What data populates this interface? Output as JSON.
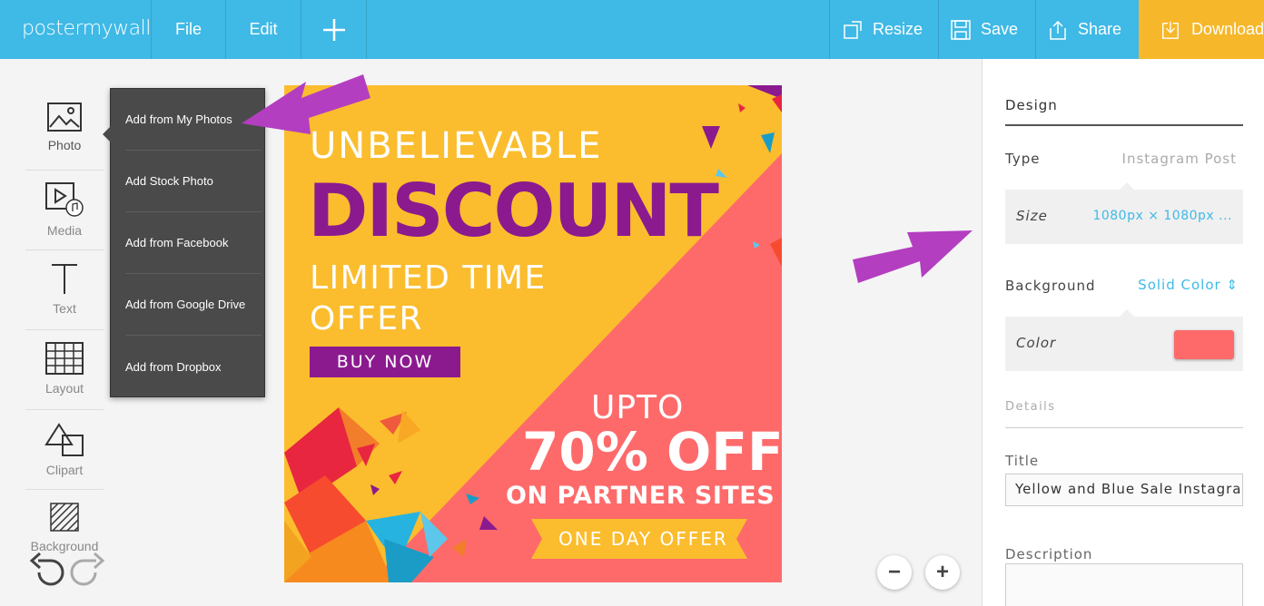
{
  "topbar": {
    "logo": "postermywall",
    "file_label": "File",
    "edit_label": "Edit",
    "add_icon": "plus-icon",
    "resize_label": "Resize",
    "save_label": "Save",
    "share_label": "Share",
    "download_label": "Download",
    "colors": {
      "bar": "#3fb9e6",
      "download": "#f6b72a"
    }
  },
  "left_tools": [
    {
      "label": "Photo",
      "icon": "photo-icon"
    },
    {
      "label": "Media",
      "icon": "media-icon"
    },
    {
      "label": "Text",
      "icon": "text-icon"
    },
    {
      "label": "Layout",
      "icon": "layout-grid-icon"
    },
    {
      "label": "Clipart",
      "icon": "clipart-icon"
    },
    {
      "label": "Background",
      "icon": "background-icon"
    }
  ],
  "photo_menu": [
    "Add from My Photos",
    "Add Stock Photo",
    "Add from Facebook",
    "Add from Google Drive",
    "Add from Dropbox"
  ],
  "poster": {
    "headline": "UNBELIEVABLE",
    "discount": "DISCOUNT",
    "limited_line1": "LIMITED TIME",
    "limited_line2": "OFFER",
    "buy_now": "BUY NOW",
    "upto": "UPTO",
    "percent_off": "70% OFF",
    "partner": "ON PARTNER SITES",
    "one_day": "ONE DAY OFFER",
    "colors": {
      "yellow": "#fbbd2e",
      "coral": "#fe6a6a",
      "purple": "#8b1a8f"
    }
  },
  "zoom": {
    "minus": "−",
    "plus": "+"
  },
  "right_panel": {
    "design_heading": "Design",
    "type_label": "Type",
    "type_value": "Instagram Post",
    "size_label": "Size",
    "size_value": "1080px × 1080px ...",
    "background_label": "Background",
    "background_value": "Solid Color ⇕",
    "color_label": "Color",
    "color_value": "#fe6a6a",
    "details_heading": "Details",
    "title_label": "Title",
    "title_value": "Yellow and Blue Sale Instagra",
    "description_label": "Description",
    "description_value": ""
  }
}
